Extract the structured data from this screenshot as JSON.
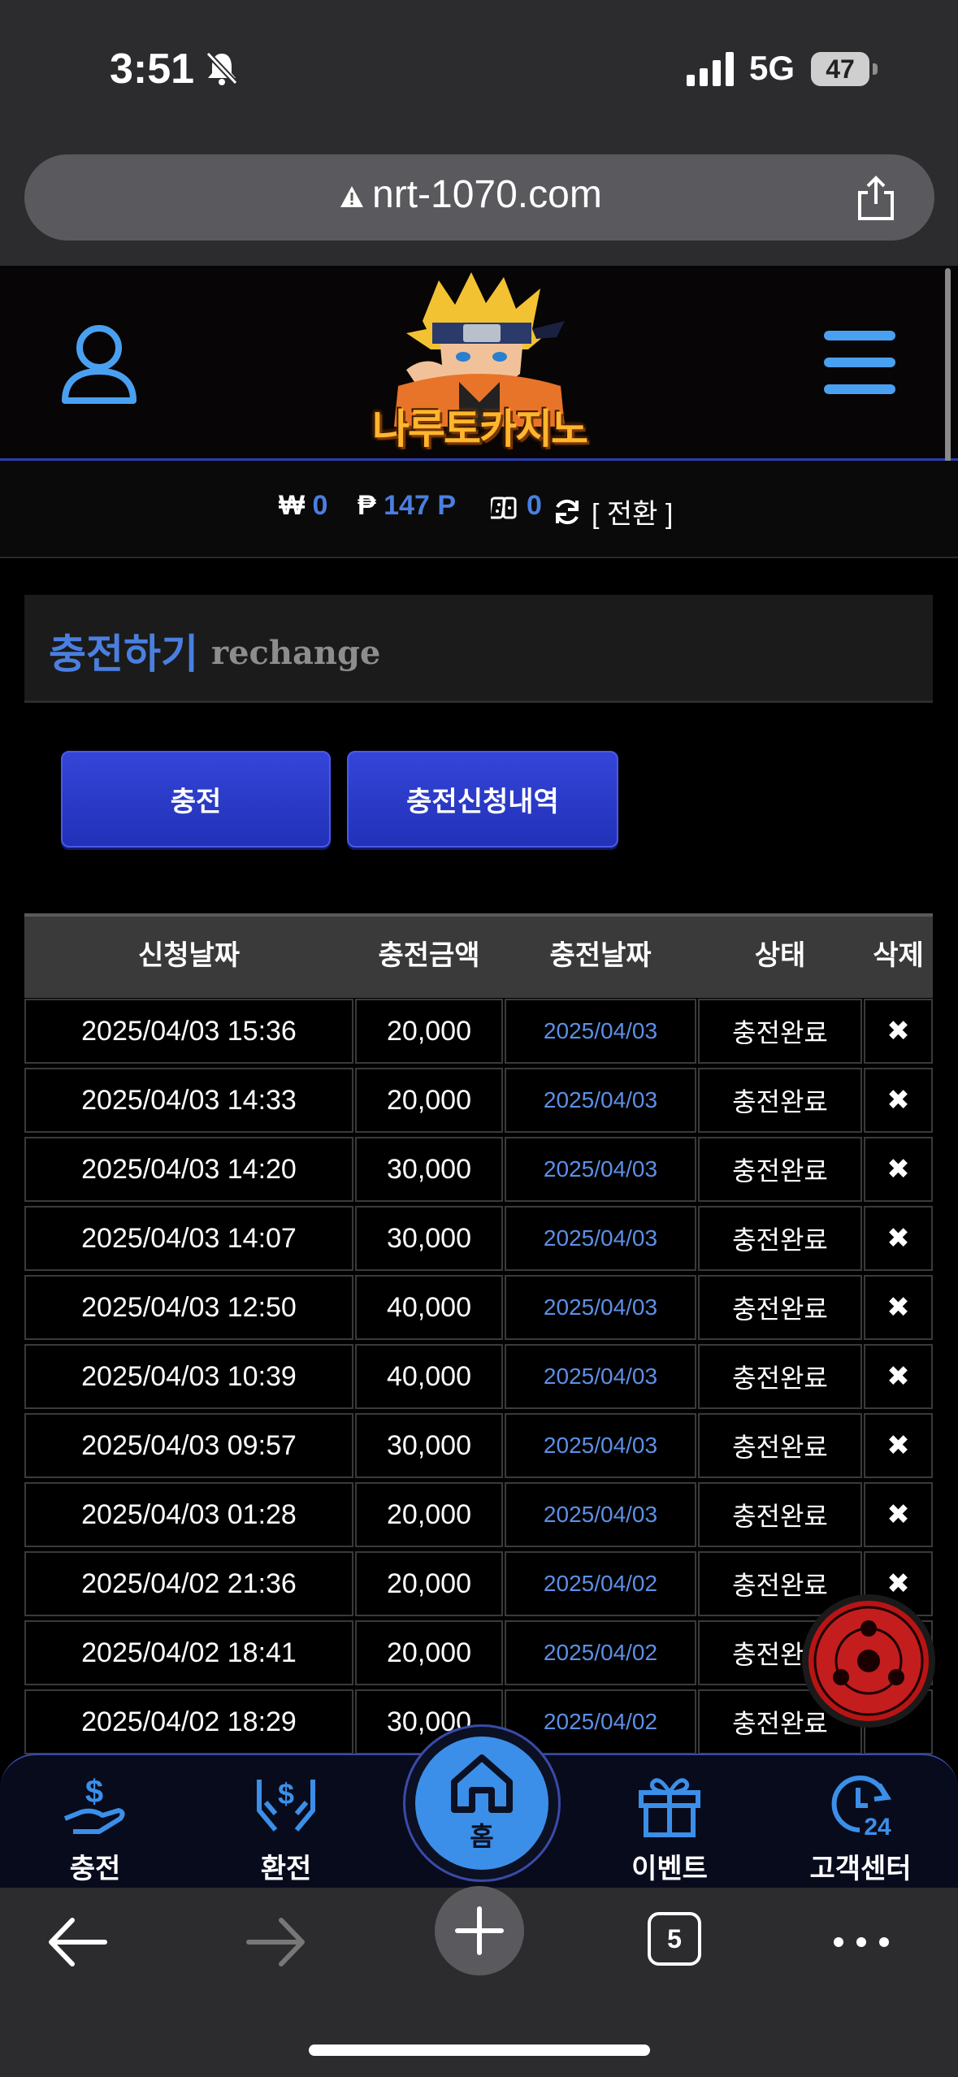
{
  "status_bar": {
    "time": "3:51",
    "network": "5G",
    "battery": "47"
  },
  "browser": {
    "url": "nrt-1070.com",
    "tab_count": "5"
  },
  "header": {
    "logo_text": "나루토카지노"
  },
  "balance": {
    "won_symbol": "₩",
    "won_value": "0",
    "point_symbol": "₱",
    "point_value": "147 P",
    "dice_value": "0",
    "convert_label": "[ 전환 ]"
  },
  "section": {
    "title_ko": "충전하기",
    "title_en": "rechange"
  },
  "buttons": {
    "charge": "충전",
    "history": "충전신청내역"
  },
  "table": {
    "headers": [
      "신청날짜",
      "충전금액",
      "충전날짜",
      "상태",
      "삭제"
    ],
    "rows": [
      {
        "requested": "2025/04/03 15:36",
        "amount": "20,000",
        "charged": "2025/04/03",
        "status": "충전완료",
        "delete": "✖"
      },
      {
        "requested": "2025/04/03 14:33",
        "amount": "20,000",
        "charged": "2025/04/03",
        "status": "충전완료",
        "delete": "✖"
      },
      {
        "requested": "2025/04/03 14:20",
        "amount": "30,000",
        "charged": "2025/04/03",
        "status": "충전완료",
        "delete": "✖"
      },
      {
        "requested": "2025/04/03 14:07",
        "amount": "30,000",
        "charged": "2025/04/03",
        "status": "충전완료",
        "delete": "✖"
      },
      {
        "requested": "2025/04/03 12:50",
        "amount": "40,000",
        "charged": "2025/04/03",
        "status": "충전완료",
        "delete": "✖"
      },
      {
        "requested": "2025/04/03 10:39",
        "amount": "40,000",
        "charged": "2025/04/03",
        "status": "충전완료",
        "delete": "✖"
      },
      {
        "requested": "2025/04/03 09:57",
        "amount": "30,000",
        "charged": "2025/04/03",
        "status": "충전완료",
        "delete": "✖"
      },
      {
        "requested": "2025/04/03 01:28",
        "amount": "20,000",
        "charged": "2025/04/03",
        "status": "충전완료",
        "delete": "✖"
      },
      {
        "requested": "2025/04/02 21:36",
        "amount": "20,000",
        "charged": "2025/04/02",
        "status": "충전완료",
        "delete": "✖"
      },
      {
        "requested": "2025/04/02 18:41",
        "amount": "20,000",
        "charged": "2025/04/02",
        "status": "충전완료",
        "delete": ""
      },
      {
        "requested": "2025/04/02 18:29",
        "amount": "30,000",
        "charged": "2025/04/02",
        "status": "충전완료",
        "delete": ""
      }
    ]
  },
  "bottom_nav": {
    "charge": "충전",
    "exchange": "환전",
    "home": "홈",
    "event": "이벤트",
    "support": "고객센터"
  },
  "colors": {
    "accent": "#4a7fe0",
    "button": "#2a3ac8",
    "nav_home": "#3b8fe8"
  }
}
